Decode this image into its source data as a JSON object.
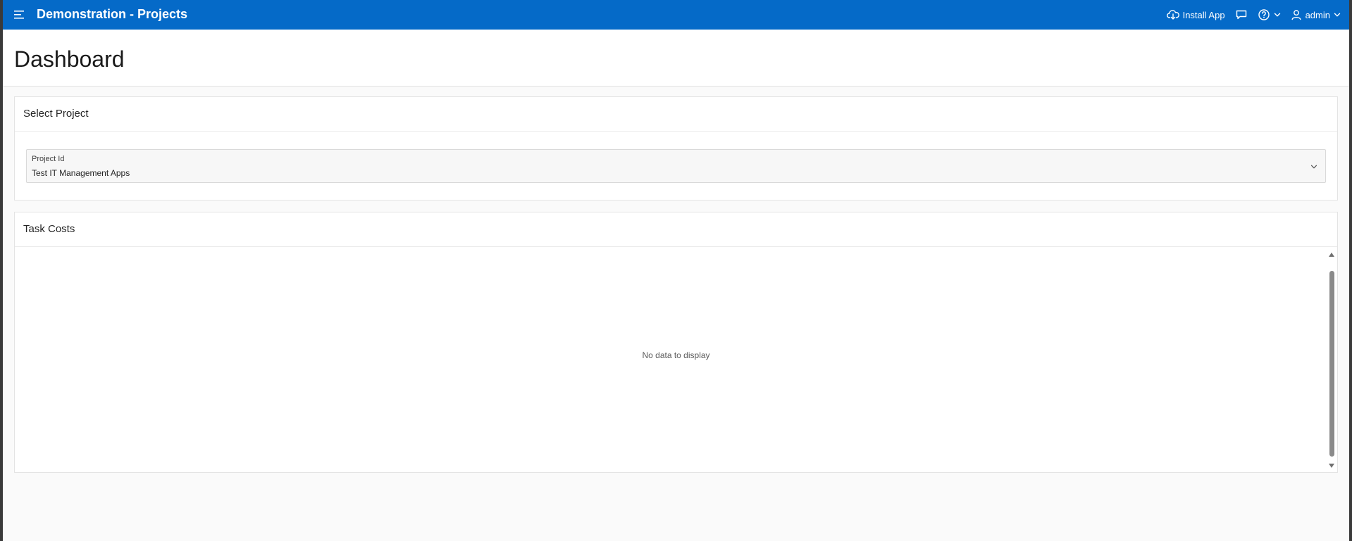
{
  "header": {
    "app_title": "Demonstration - Projects",
    "install_label": "Install App",
    "user_label": "admin",
    "bg_color": "#056ac8"
  },
  "page": {
    "title": "Dashboard"
  },
  "select_project": {
    "title": "Select Project",
    "field_label": "Project Id",
    "field_value": "Test IT Management Apps"
  },
  "task_costs": {
    "title": "Task Costs",
    "empty_message": "No data to display"
  },
  "icons": {
    "menu": "hamburger-menu-icon",
    "install": "cloud-download-icon",
    "feedback": "chat-bubble-icon",
    "help": "question-circle-icon",
    "user": "user-icon",
    "chevron": "chevron-down-icon"
  }
}
